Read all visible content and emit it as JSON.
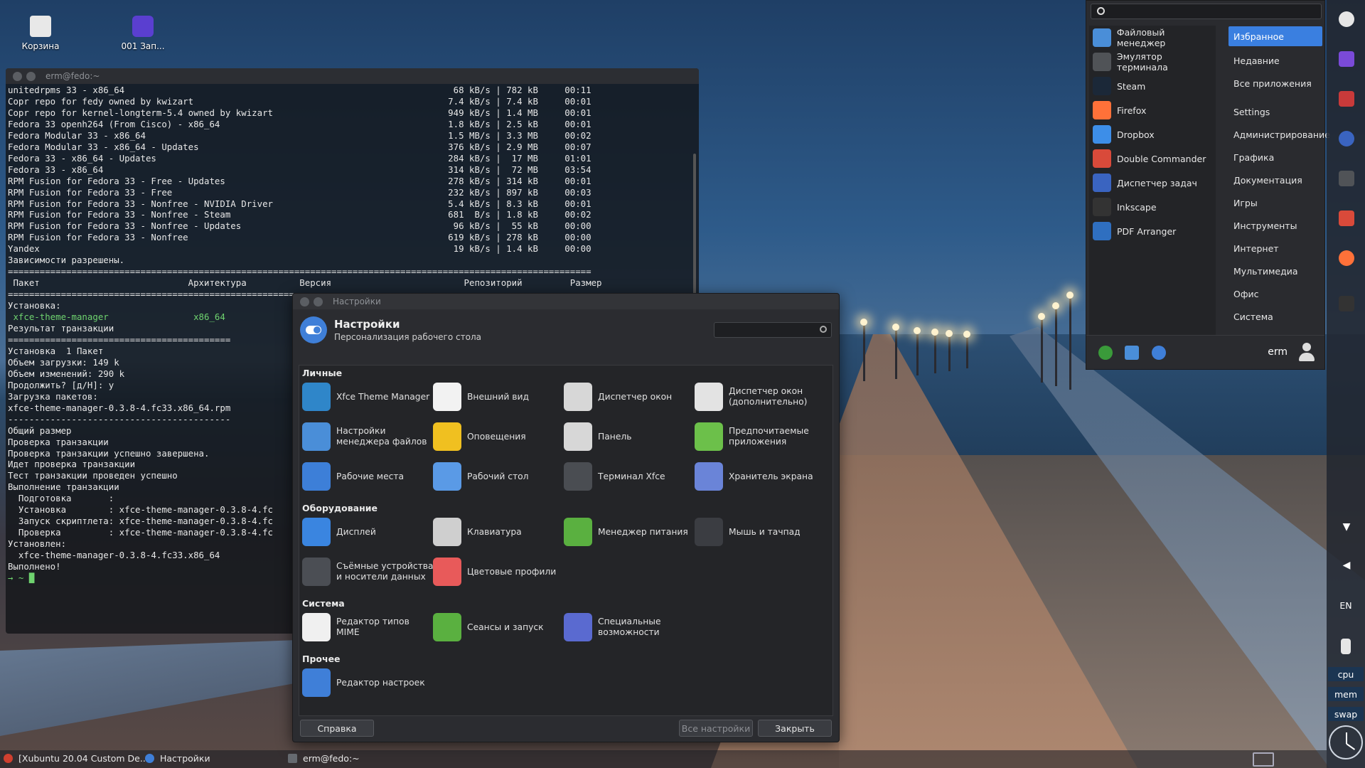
{
  "desktop": {
    "icons": [
      {
        "label": "Корзина"
      },
      {
        "label": "001 Зап..."
      }
    ]
  },
  "terminal": {
    "title": "erm@fedo:~",
    "lines": [
      "unitedrpms 33 - x86_64                                                              68 kB/s | 782 kB     00:11",
      "Copr repo for fedy owned by kwizart                                                7.4 kB/s | 7.4 kB     00:01",
      "Copr repo for kernel-longterm-5.4 owned by kwizart                                 949 kB/s | 1.4 MB     00:01",
      "Fedora 33 openh264 (From Cisco) - x86_64                                           1.8 kB/s | 2.5 kB     00:01",
      "Fedora Modular 33 - x86_64                                                         1.5 MB/s | 3.3 MB     00:02",
      "Fedora Modular 33 - x86_64 - Updates                                               376 kB/s | 2.9 MB     00:07",
      "Fedora 33 - x86_64 - Updates                                                       284 kB/s |  17 MB     01:01",
      "Fedora 33 - x86_64                                                                 314 kB/s |  72 MB     03:54",
      "RPM Fusion for Fedora 33 - Free - Updates                                          278 kB/s | 314 kB     00:01",
      "RPM Fusion for Fedora 33 - Free                                                    232 kB/s | 897 kB     00:03",
      "RPM Fusion for Fedora 33 - Nonfree - NVIDIA Driver                                 5.4 kB/s | 8.3 kB     00:01",
      "RPM Fusion for Fedora 33 - Nonfree - Steam                                         681  B/s | 1.8 kB     00:02",
      "RPM Fusion for Fedora 33 - Nonfree - Updates                                        96 kB/s |  55 kB     00:00",
      "RPM Fusion for Fedora 33 - Nonfree                                                 619 kB/s | 278 kB     00:00",
      "Yandex                                                                              19 kB/s | 1.4 kB     00:00",
      "Зависимости разрешены.",
      "==============================================================================================================",
      " Пакет                            Архитектура          Версия                         Репозиторий         Размер",
      "==============================================================================================================",
      "Установка:",
      " xfce-theme-manager                x86_64",
      "",
      "Результат транзакции",
      "==========================================",
      "Установка  1 Пакет",
      "",
      "Объем загрузки: 149 k",
      "Объем изменений: 290 k",
      "Продолжить? [д/Н]: y",
      "Загрузка пакетов:",
      "xfce-theme-manager-0.3.8-4.fc33.x86_64.rpm",
      "------------------------------------------",
      "Общий размер",
      "Проверка транзакции",
      "Проверка транзакции успешно завершена.",
      "Идет проверка транзакции",
      "Тест транзакции проведен успешно",
      "Выполнение транзакции",
      "  Подготовка       :",
      "  Установка        : xfce-theme-manager-0.3.8-4.fc",
      "  Запуск скриптлета: xfce-theme-manager-0.3.8-4.fc",
      "  Проверка         : xfce-theme-manager-0.3.8-4.fc",
      "",
      "Установлен:",
      "  xfce-theme-manager-0.3.8-4.fc33.x86_64",
      "",
      "Выполнено!",
      "→ ~ █"
    ]
  },
  "settings": {
    "window_title": "Настройки",
    "title": "Настройки",
    "subtitle": "Персонализация рабочего стола",
    "search_placeholder": "",
    "categories": [
      {
        "name": "Личные",
        "items": [
          {
            "label": "Xfce Theme Manager",
            "icon": "theme-manager-icon",
            "color": "#2f86c9"
          },
          {
            "label": "Внешний вид",
            "icon": "appearance-icon",
            "color": "#f2f2f2"
          },
          {
            "label": "Диспетчер окон",
            "icon": "window-manager-icon",
            "color": "#d7d7d7"
          },
          {
            "label": "Диспетчер окон (дополнительно)",
            "icon": "window-manager-tweaks-icon",
            "color": "#e3e3e3"
          },
          {
            "label": "Настройки менеджера файлов",
            "icon": "file-manager-settings-icon",
            "color": "#4a8ed8"
          },
          {
            "label": "Оповещения",
            "icon": "notifications-icon",
            "color": "#f0c020"
          },
          {
            "label": "Панель",
            "icon": "panel-icon",
            "color": "#d7d7d7"
          },
          {
            "label": "Предпочитаемые приложения",
            "icon": "preferred-apps-icon",
            "color": "#6cc04a"
          },
          {
            "label": "Рабочие места",
            "icon": "workspaces-icon",
            "color": "#3d7fd8"
          },
          {
            "label": "Рабочий стол",
            "icon": "desktop-icon",
            "color": "#5a9ae6"
          },
          {
            "label": "Терминал Xfce",
            "icon": "terminal-icon",
            "color": "#4a4d52"
          },
          {
            "label": "Хранитель экрана",
            "icon": "screensaver-icon",
            "color": "#6a84d8"
          }
        ]
      },
      {
        "name": "Оборудование",
        "items": [
          {
            "label": "Дисплей",
            "icon": "display-icon",
            "color": "#3a85e0"
          },
          {
            "label": "Клавиатура",
            "icon": "keyboard-icon",
            "color": "#cfcfcf"
          },
          {
            "label": "Менеджер питания",
            "icon": "power-manager-icon",
            "color": "#5ab040"
          },
          {
            "label": "Мышь и тачпад",
            "icon": "mouse-icon",
            "color": "#3b3d42"
          },
          {
            "label": "Съёмные устройства и носители данных",
            "icon": "removable-drives-icon",
            "color": "#4b4e54"
          },
          {
            "label": "Цветовые профили",
            "icon": "color-profiles-icon",
            "color": "#e85a5a"
          }
        ]
      },
      {
        "name": "Система",
        "items": [
          {
            "label": "Редактор типов MIME",
            "icon": "mime-editor-icon",
            "color": "#f0f0f0"
          },
          {
            "label": "Сеансы и запуск",
            "icon": "sessions-icon",
            "color": "#5ab040"
          },
          {
            "label": "Специальные возможности",
            "icon": "accessibility-icon",
            "color": "#5a6ad0"
          }
        ]
      },
      {
        "name": "Прочее",
        "items": [
          {
            "label": "Редактор настроек",
            "icon": "settings-editor-icon",
            "color": "#3f7fd8"
          }
        ]
      }
    ],
    "buttons": {
      "help": "Справка",
      "all": "Все настройки",
      "close": "Закрыть"
    }
  },
  "menu": {
    "search_placeholder": "",
    "favorites": [
      {
        "label": "Файловый менеджер",
        "icon": "file-manager-icon",
        "color": "#4a8ed8"
      },
      {
        "label": "Эмулятор терминала",
        "icon": "terminal-icon",
        "color": "#505357"
      },
      {
        "label": "Steam",
        "icon": "steam-icon",
        "color": "#1b2838"
      },
      {
        "label": "Firefox",
        "icon": "firefox-icon",
        "color": "#ff7139"
      },
      {
        "label": "Dropbox",
        "icon": "dropbox-icon",
        "color": "#3d8ee8"
      },
      {
        "label": "Double Commander",
        "icon": "double-commander-icon",
        "color": "#d94a3a"
      },
      {
        "label": "Диспетчер задач",
        "icon": "task-manager-icon",
        "color": "#3a64c0"
      },
      {
        "label": "Inkscape",
        "icon": "inkscape-icon",
        "color": "#333333"
      },
      {
        "label": "PDF Arranger",
        "icon": "pdf-arranger-icon",
        "color": "#2f6fc0"
      }
    ],
    "categories": [
      {
        "label": "Избранное",
        "active": true
      },
      {
        "label": "Недавние"
      },
      {
        "label": "Все приложения"
      },
      {
        "label": "Settings",
        "gap": true
      },
      {
        "label": "Администрирование"
      },
      {
        "label": "Графика"
      },
      {
        "label": "Документация"
      },
      {
        "label": "Игры"
      },
      {
        "label": "Инструменты"
      },
      {
        "label": "Интернет"
      },
      {
        "label": "Мультимедиа"
      },
      {
        "label": "Офис"
      },
      {
        "label": "Система"
      }
    ],
    "user": "erm"
  },
  "panel": {
    "lang": "EN",
    "monitors": [
      "cpu",
      "mem",
      "swap"
    ]
  },
  "taskbar": {
    "tasks": [
      {
        "label": "[Xubuntu 20.04 Custom De...",
        "color": "#d0402f"
      },
      {
        "label": "Настройки",
        "color": "#3f7fd8"
      },
      {
        "label": "erm@fedo:~",
        "color": "#666a70"
      }
    ]
  }
}
